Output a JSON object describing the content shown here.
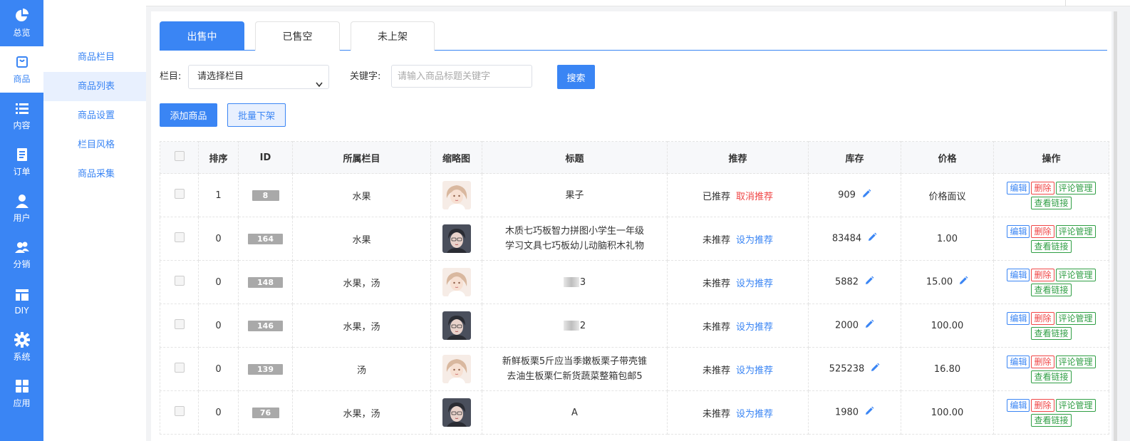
{
  "sidebar": {
    "items": [
      {
        "label": "总览",
        "icon": "pie-chart-icon"
      },
      {
        "label": "商品",
        "icon": "shopping-bag-icon",
        "active": true
      },
      {
        "label": "内容",
        "icon": "list-icon"
      },
      {
        "label": "订单",
        "icon": "document-icon"
      },
      {
        "label": "用户",
        "icon": "user-icon"
      },
      {
        "label": "分销",
        "icon": "users-icon"
      },
      {
        "label": "DIY",
        "icon": "layout-icon"
      },
      {
        "label": "系统",
        "icon": "gear-icon"
      },
      {
        "label": "应用",
        "icon": "grid-icon"
      }
    ]
  },
  "submenu": {
    "items": [
      {
        "label": "商品栏目"
      },
      {
        "label": "商品列表",
        "active": true
      },
      {
        "label": "商品设置"
      },
      {
        "label": "栏目风格"
      },
      {
        "label": "商品采集"
      }
    ]
  },
  "tabs": [
    {
      "label": "出售中",
      "active": true
    },
    {
      "label": "已售空"
    },
    {
      "label": "未上架"
    }
  ],
  "filter": {
    "category_label": "栏目:",
    "category_value": "请选择栏目",
    "keyword_label": "关键字:",
    "keyword_placeholder": "请输入商品标题关键字",
    "search_label": "搜索"
  },
  "actions": {
    "add_label": "添加商品",
    "batch_label": "批量下架"
  },
  "table": {
    "headers": [
      "",
      "排序",
      "ID",
      "所属栏目",
      "缩略图",
      "标题",
      "推荐",
      "库存",
      "价格",
      "操作"
    ],
    "op_labels": {
      "edit": "编辑",
      "delete": "删除",
      "comments": "评论管理",
      "view_link": "查看链接"
    },
    "rows": [
      {
        "sort": "1",
        "id": "8",
        "category": "水果",
        "thumb": "girl",
        "title_lines": [
          "果子"
        ],
        "rec_status": "已推荐",
        "rec_action": "取消推荐",
        "rec_cancel": true,
        "stock": "909",
        "price": "价格面议",
        "price_editable": false
      },
      {
        "sort": "0",
        "id": "164",
        "category": "水果",
        "thumb": "boy",
        "title_lines": [
          "木质七巧板智力拼图小学生一年级",
          "学习文具七巧板幼儿动脑积木礼物"
        ],
        "rec_status": "未推荐",
        "rec_action": "设为推荐",
        "rec_cancel": false,
        "stock": "83484",
        "price": "1.00",
        "price_editable": false
      },
      {
        "sort": "0",
        "id": "148",
        "category": "水果，汤",
        "thumb": "girl",
        "title_lines": [
          "3"
        ],
        "title_blurred": true,
        "rec_status": "未推荐",
        "rec_action": "设为推荐",
        "rec_cancel": false,
        "stock": "5882",
        "price": "15.00",
        "price_editable": true
      },
      {
        "sort": "0",
        "id": "146",
        "category": "水果，汤",
        "thumb": "boy",
        "title_lines": [
          "2"
        ],
        "title_blurred": true,
        "rec_status": "未推荐",
        "rec_action": "设为推荐",
        "rec_cancel": false,
        "stock": "2000",
        "price": "100.00",
        "price_editable": false
      },
      {
        "sort": "0",
        "id": "139",
        "category": "汤",
        "thumb": "girl",
        "title_lines": [
          "新鲜板栗5斤应当季嫩板栗子带壳锥",
          "去油生板栗仁新货蔬菜整箱包邮5"
        ],
        "rec_status": "未推荐",
        "rec_action": "设为推荐",
        "rec_cancel": false,
        "stock": "525238",
        "price": "16.80",
        "price_editable": false
      },
      {
        "sort": "0",
        "id": "76",
        "category": "水果，汤",
        "thumb": "boy",
        "title_lines": [
          "A"
        ],
        "rec_status": "未推荐",
        "rec_action": "设为推荐",
        "rec_cancel": false,
        "stock": "1980",
        "price": "100.00",
        "price_editable": false
      }
    ]
  },
  "colors": {
    "primary": "#3a85f4",
    "danger": "#f04646",
    "success": "#2f9e44"
  }
}
